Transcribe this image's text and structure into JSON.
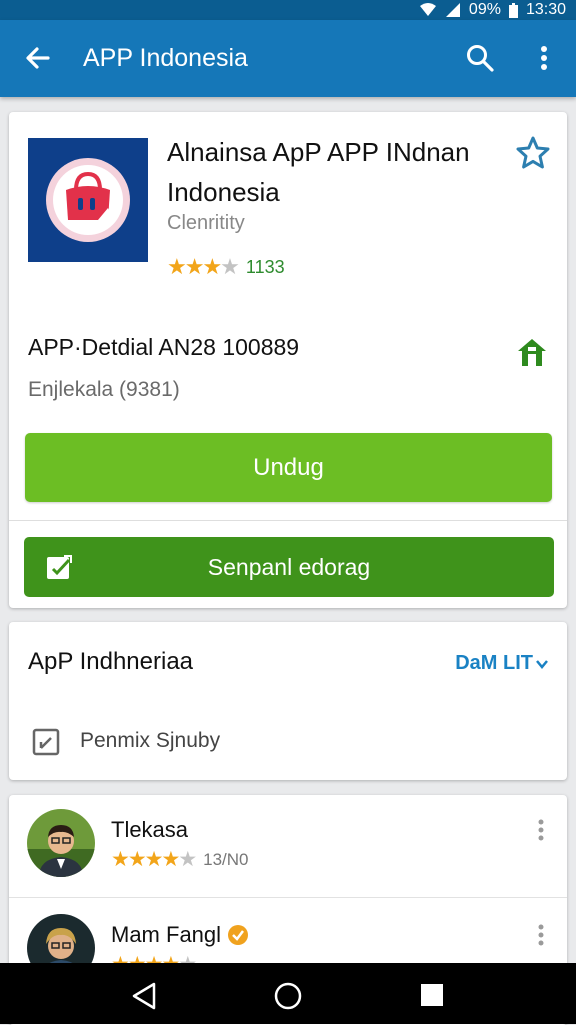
{
  "status_bar": {
    "battery": "09%",
    "time": "13:30"
  },
  "app_bar": {
    "title": "APP Indonesia",
    "back_icon": "arrow-left-icon",
    "search_icon": "search-icon",
    "more_icon": "more-vert-icon"
  },
  "app": {
    "name": "Alnainsa ApP APP INdnan Indonesia",
    "category": "Clenritity",
    "rating_stars": 3,
    "rating_count": "1133",
    "icon_bg": "#0e3f8a",
    "detail": "APP·Detdial AN28  100889",
    "detail_sub": "Enjlekala (9381)"
  },
  "buttons": {
    "download": "Undug",
    "secondary": "Senpanl edorag"
  },
  "colors": {
    "app_bar": "#1577b8",
    "download": "#6cbe24",
    "secondary": "#3f931b",
    "star": "#f2a51a",
    "link": "#1a82c4"
  },
  "section": {
    "title": "ApP Indhneriaa",
    "link": "DaM LIT",
    "item_label": "Penmix Sjnuby"
  },
  "reviews": [
    {
      "name": "Tlekasa",
      "stars": 4,
      "count": "13/N0",
      "verified": false
    },
    {
      "name": "Mam Fangl",
      "stars": 4,
      "count": "",
      "verified": true
    }
  ],
  "nav_bar": {
    "back_icon": "nav-back-icon",
    "home_icon": "nav-home-icon",
    "recent_icon": "nav-recent-icon"
  }
}
